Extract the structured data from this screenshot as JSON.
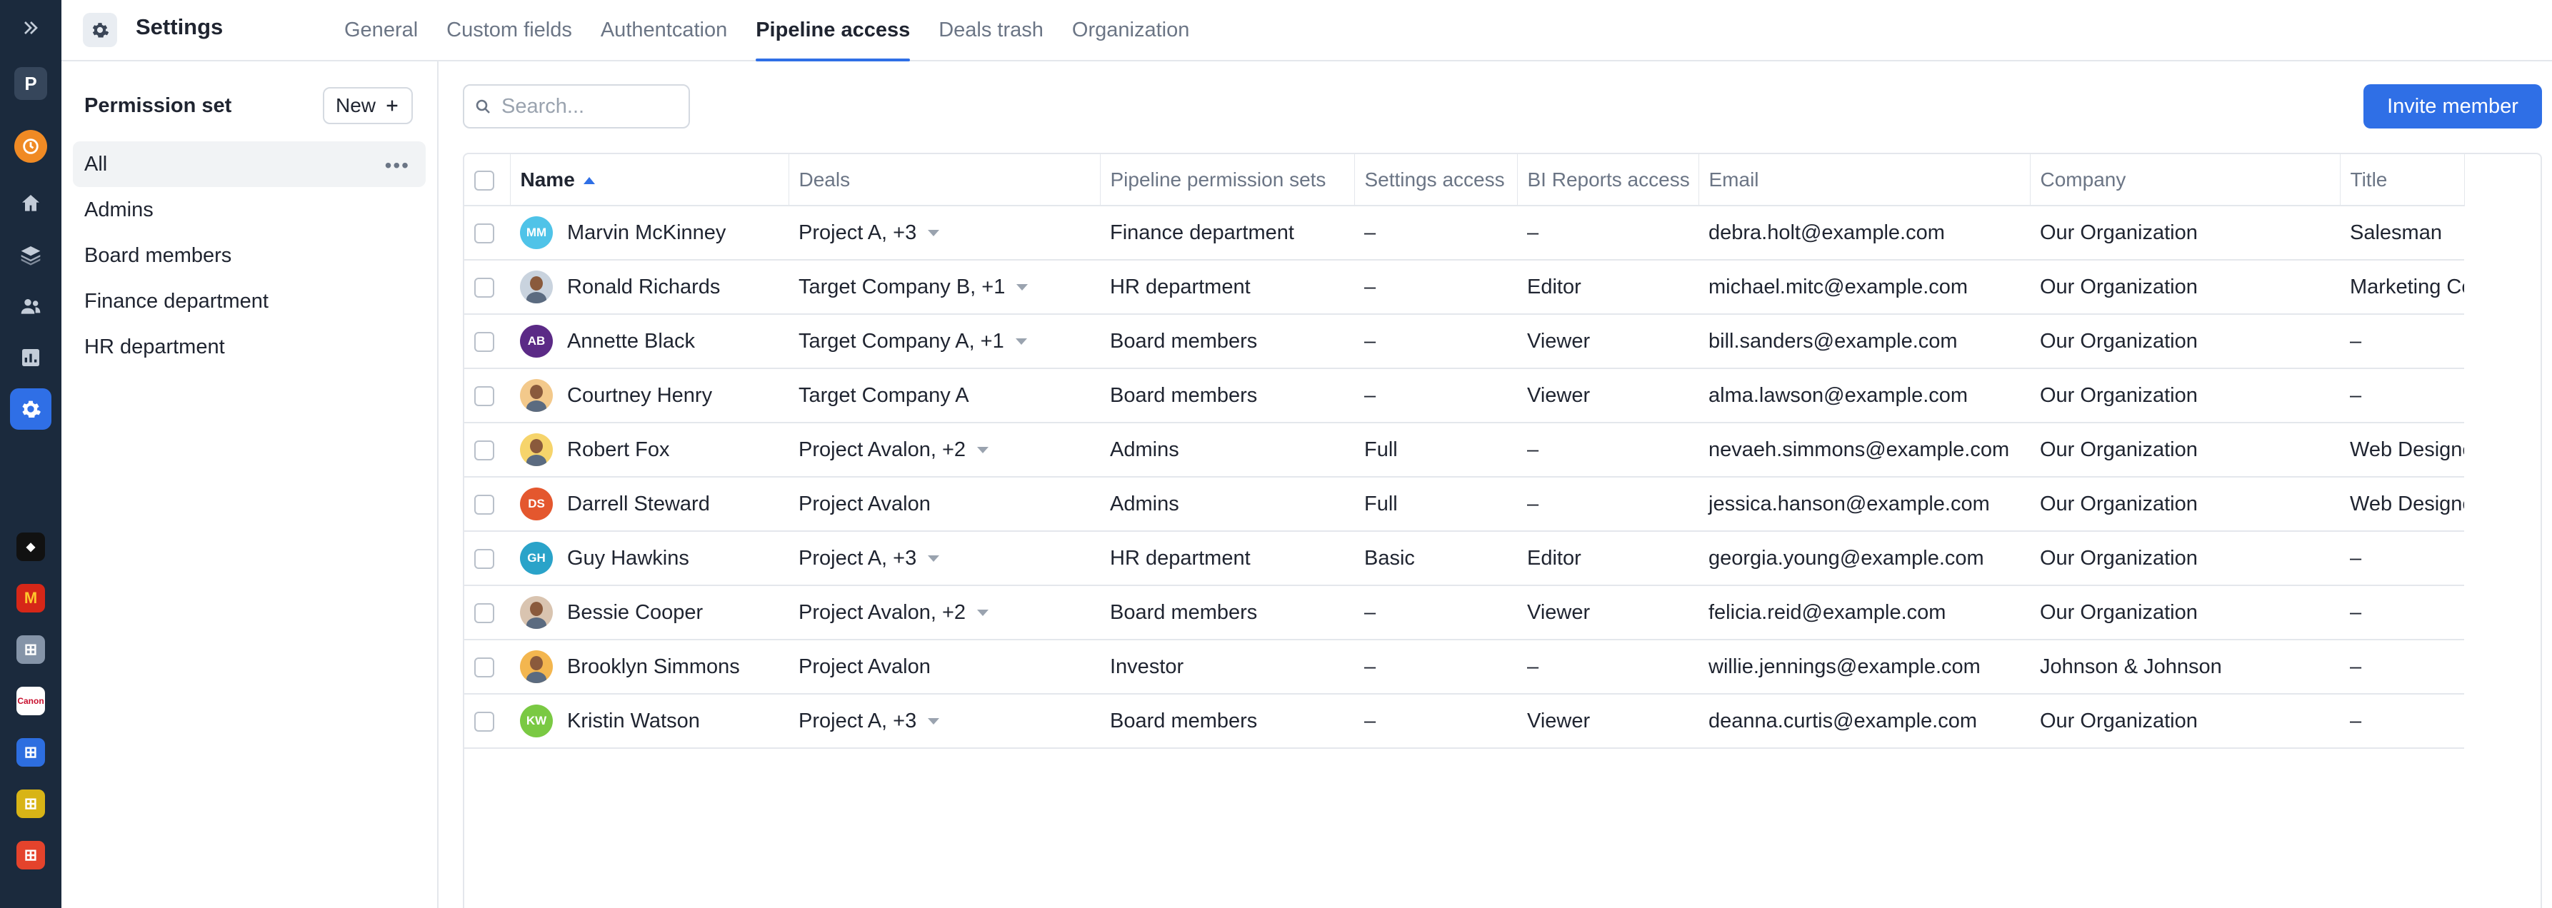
{
  "rail": {
    "workspace_initial": "P",
    "icons": [
      "expand-icon",
      "clock-icon",
      "home-icon",
      "layers-icon",
      "people-icon",
      "chart-icon",
      "gear-icon"
    ],
    "apps": [
      {
        "name": "dark-app-icon",
        "color": "#111111",
        "glyph": "◆"
      },
      {
        "name": "mcdonalds-icon",
        "color": "#d62718",
        "glyph": "M"
      },
      {
        "name": "grid-app-icon-1",
        "color": "#8594a8",
        "glyph": "⊞"
      },
      {
        "name": "canon-icon",
        "color": "#ffffff",
        "glyph": "C"
      },
      {
        "name": "grid-app-icon-2",
        "color": "#2d6ee0",
        "glyph": "⊞"
      },
      {
        "name": "grid-app-icon-3",
        "color": "#d8b416",
        "glyph": "⊞"
      },
      {
        "name": "grid-app-icon-4",
        "color": "#e4432c",
        "glyph": "⊞"
      }
    ]
  },
  "header": {
    "title": "Settings",
    "tabs": [
      {
        "label": "General",
        "active": false
      },
      {
        "label": "Custom fields",
        "active": false
      },
      {
        "label": "Authentcation",
        "active": false
      },
      {
        "label": "Pipeline access",
        "active": true
      },
      {
        "label": "Deals trash",
        "active": false
      },
      {
        "label": "Organization",
        "active": false
      }
    ]
  },
  "permission_sets": {
    "heading": "Permission set",
    "new_label": "New",
    "items": [
      {
        "label": "All",
        "active": true
      },
      {
        "label": "Admins",
        "active": false
      },
      {
        "label": "Board members",
        "active": false
      },
      {
        "label": "Finance department",
        "active": false
      },
      {
        "label": "HR department",
        "active": false
      }
    ]
  },
  "search": {
    "placeholder": "Search..."
  },
  "invite_label": "Invite member",
  "table": {
    "columns": [
      "Name",
      "Deals",
      "Pipeline permission sets",
      "Settings access",
      "BI Reports access",
      "Email",
      "Company",
      "Title"
    ],
    "rows": [
      {
        "initials": "MM",
        "avatar_color": "#4fc3e8",
        "photo": false,
        "name": "Marvin McKinney",
        "deals": "Project A, +3",
        "deals_menu": true,
        "pipeline": "Finance department",
        "settings": "–",
        "bi": "–",
        "email": "debra.holt@example.com",
        "company": "Our Organization",
        "title": "Salesman"
      },
      {
        "initials": "",
        "avatar_color": "#c9d3de",
        "photo": true,
        "name": "Ronald Richards",
        "deals": "Target Company B, +1",
        "deals_menu": true,
        "pipeline": "HR department",
        "settings": "–",
        "bi": "Editor",
        "email": "michael.mitc@example.com",
        "company": "Our Organization",
        "title": "Marketing Coordinator"
      },
      {
        "initials": "AB",
        "avatar_color": "#5b2a86",
        "photo": false,
        "name": "Annette Black",
        "deals": "Target Company A, +1",
        "deals_menu": true,
        "pipeline": "Board members",
        "settings": "–",
        "bi": "Viewer",
        "email": "bill.sanders@example.com",
        "company": "Our Organization",
        "title": "–"
      },
      {
        "initials": "",
        "avatar_color": "#f3c98b",
        "photo": true,
        "name": "Courtney Henry",
        "deals": "Target Company A",
        "deals_menu": false,
        "pipeline": "Board members",
        "settings": "–",
        "bi": "Viewer",
        "email": "alma.lawson@example.com",
        "company": "Our Organization",
        "title": "–"
      },
      {
        "initials": "",
        "avatar_color": "#f6d46b",
        "photo": true,
        "name": "Robert Fox",
        "deals": "Project Avalon, +2",
        "deals_menu": true,
        "pipeline": "Admins",
        "settings": "Full",
        "bi": "–",
        "email": "nevaeh.simmons@example.com",
        "company": "Our Organization",
        "title": "Web Designer"
      },
      {
        "initials": "DS",
        "avatar_color": "#e4572e",
        "photo": false,
        "name": "Darrell Steward",
        "deals": "Project Avalon",
        "deals_menu": false,
        "pipeline": "Admins",
        "settings": "Full",
        "bi": "–",
        "email": "jessica.hanson@example.com",
        "company": "Our Organization",
        "title": "Web Designer"
      },
      {
        "initials": "GH",
        "avatar_color": "#2aa3c9",
        "photo": false,
        "name": "Guy Hawkins",
        "deals": "Project A, +3",
        "deals_menu": true,
        "pipeline": "HR department",
        "settings": "Basic",
        "bi": "Editor",
        "email": "georgia.young@example.com",
        "company": "Our Organization",
        "title": "–"
      },
      {
        "initials": "",
        "avatar_color": "#d9c4b0",
        "photo": true,
        "name": "Bessie Cooper",
        "deals": "Project Avalon, +2",
        "deals_menu": true,
        "pipeline": "Board members",
        "settings": "–",
        "bi": "Viewer",
        "email": "felicia.reid@example.com",
        "company": "Our Organization",
        "title": "–"
      },
      {
        "initials": "",
        "avatar_color": "#f3b64f",
        "photo": true,
        "name": "Brooklyn Simmons",
        "deals": "Project Avalon",
        "deals_menu": false,
        "pipeline": "Investor",
        "settings": "–",
        "bi": "–",
        "email": "willie.jennings@example.com",
        "company": "Johnson & Johnson",
        "title": "–"
      },
      {
        "initials": "KW",
        "avatar_color": "#7ac943",
        "photo": false,
        "name": "Kristin Watson",
        "deals": "Project A, +3",
        "deals_menu": true,
        "pipeline": "Board members",
        "settings": "–",
        "bi": "Viewer",
        "email": "deanna.curtis@example.com",
        "company": "Our Organization",
        "title": "–"
      }
    ]
  }
}
